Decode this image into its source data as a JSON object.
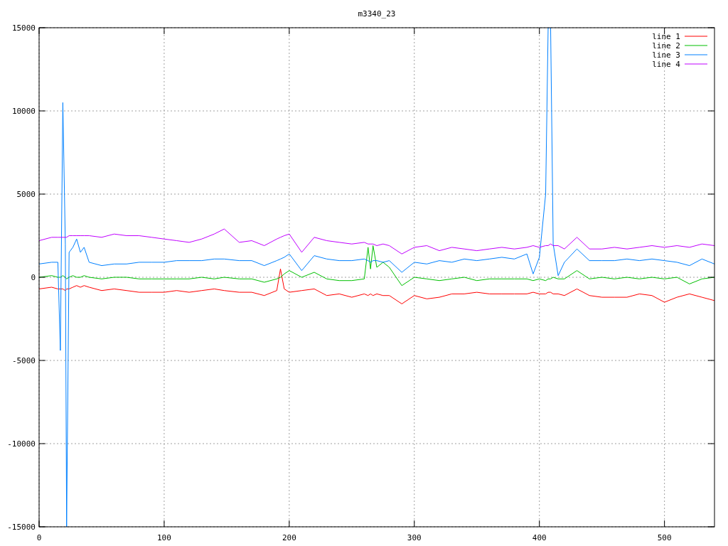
{
  "chart_data": {
    "type": "line",
    "title": "m3340_23",
    "x": [
      0,
      10,
      15,
      17,
      19,
      21,
      22,
      24,
      27,
      30,
      33,
      36,
      40,
      50,
      60,
      70,
      80,
      90,
      100,
      110,
      120,
      130,
      140,
      148,
      160,
      170,
      180,
      190,
      193,
      196,
      200,
      210,
      220,
      230,
      240,
      250,
      260,
      263,
      265,
      267,
      270,
      275,
      280,
      290,
      300,
      310,
      320,
      330,
      340,
      350,
      360,
      370,
      380,
      390,
      395,
      400,
      405,
      407,
      409,
      411,
      415,
      420,
      430,
      440,
      450,
      460,
      470,
      480,
      490,
      500,
      510,
      520,
      530,
      540
    ],
    "series": [
      {
        "name": "line 1",
        "color": "#ff0000",
        "values": [
          -700,
          -600,
          -700,
          -700,
          -700,
          -800,
          -700,
          -700,
          -600,
          -500,
          -600,
          -500,
          -600,
          -800,
          -700,
          -800,
          -900,
          -900,
          -900,
          -800,
          -900,
          -800,
          -700,
          -800,
          -900,
          -900,
          -1100,
          -800,
          500,
          -700,
          -900,
          -800,
          -700,
          -1100,
          -1000,
          -1200,
          -1000,
          -1100,
          -1000,
          -1100,
          -1000,
          -1100,
          -1100,
          -1600,
          -1100,
          -1300,
          -1200,
          -1000,
          -1000,
          -900,
          -1000,
          -1000,
          -1000,
          -1000,
          -900,
          -1000,
          -1000,
          -900,
          -900,
          -1000,
          -1000,
          -1100,
          -700,
          -1100,
          -1200,
          -1200,
          -1200,
          -1000,
          -1100,
          -1500,
          -1200,
          -1000,
          -1200,
          -1400
        ]
      },
      {
        "name": "line 2",
        "color": "#00c000",
        "values": [
          0,
          100,
          0,
          0,
          100,
          0,
          -100,
          0,
          100,
          0,
          0,
          100,
          0,
          -100,
          0,
          0,
          -100,
          -100,
          -100,
          -100,
          -100,
          0,
          -100,
          0,
          -100,
          -100,
          -300,
          -100,
          0,
          200,
          400,
          0,
          300,
          -100,
          -200,
          -200,
          -100,
          1800,
          500,
          1900,
          600,
          900,
          600,
          -500,
          0,
          -100,
          -200,
          -100,
          0,
          -200,
          -100,
          -100,
          -100,
          -100,
          -200,
          -100,
          -200,
          -100,
          -100,
          0,
          -100,
          -100,
          400,
          -100,
          0,
          -100,
          0,
          -100,
          0,
          -100,
          0,
          -400,
          -100,
          0
        ]
      },
      {
        "name": "line 3",
        "color": "#0080ff",
        "values": [
          800,
          900,
          900,
          -4400,
          10500,
          2000,
          -15000,
          1500,
          1800,
          2300,
          1500,
          1800,
          900,
          700,
          800,
          800,
          900,
          900,
          900,
          1000,
          1000,
          1000,
          1100,
          1100,
          1000,
          1000,
          700,
          1000,
          1100,
          1200,
          1400,
          400,
          1300,
          1100,
          1000,
          1000,
          1100,
          1000,
          900,
          1000,
          1000,
          900,
          1000,
          300,
          900,
          800,
          1000,
          900,
          1100,
          1000,
          1100,
          1200,
          1100,
          1400,
          200,
          1200,
          5000,
          15000,
          15000,
          2000,
          100,
          900,
          1700,
          1000,
          1000,
          1000,
          1100,
          1000,
          1100,
          1000,
          900,
          700,
          1100,
          800
        ]
      },
      {
        "name": "line 4",
        "color": "#c000ff",
        "values": [
          2200,
          2400,
          2400,
          2400,
          2400,
          2400,
          2400,
          2500,
          2500,
          2500,
          2500,
          2500,
          2500,
          2400,
          2600,
          2500,
          2500,
          2400,
          2300,
          2200,
          2100,
          2300,
          2600,
          2900,
          2100,
          2200,
          1900,
          2300,
          2400,
          2500,
          2600,
          1500,
          2400,
          2200,
          2100,
          2000,
          2100,
          2000,
          2000,
          2000,
          1900,
          2000,
          1900,
          1400,
          1800,
          1900,
          1600,
          1800,
          1700,
          1600,
          1700,
          1800,
          1700,
          1800,
          1900,
          1800,
          1900,
          1900,
          2000,
          1900,
          1900,
          1700,
          2400,
          1700,
          1700,
          1800,
          1700,
          1800,
          1900,
          1800,
          1900,
          1800,
          2000,
          1900
        ]
      }
    ],
    "xlim": [
      0,
      540
    ],
    "ylim": [
      -15000,
      15000
    ],
    "xticks": [
      0,
      100,
      200,
      300,
      400,
      500
    ],
    "yticks": [
      -15000,
      -10000,
      -5000,
      0,
      5000,
      10000,
      15000
    ],
    "grid": true,
    "legend": true
  }
}
